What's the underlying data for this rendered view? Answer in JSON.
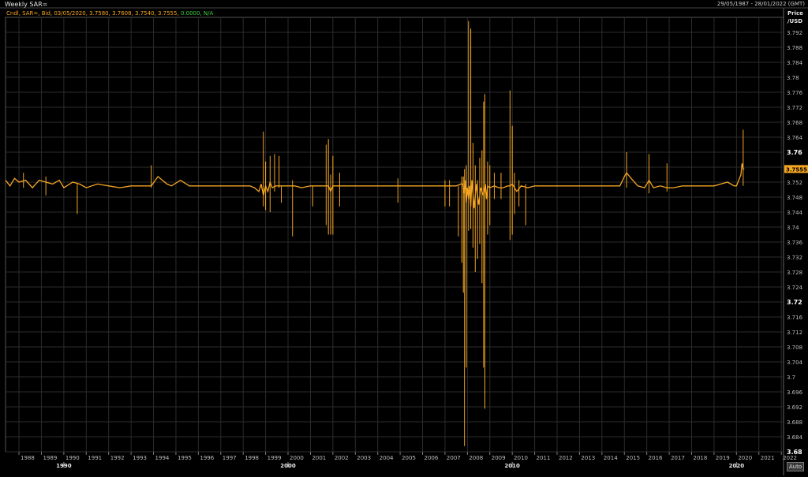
{
  "header": {
    "title": "Weekly SAR=",
    "date_range": "29/05/1987 - 28/01/2022 (GMT)"
  },
  "legend": {
    "series_text": "Cndl, SAR=, Bid, 03/05/2020, 3.7580, 3.7608, 3.7540, 3.7555,",
    "change_text": "0.0000, N/A"
  },
  "axis": {
    "units_line1": "Price",
    "units_line2": "/USD",
    "auto_label": "Auto"
  },
  "colors": {
    "series": "#f5a623",
    "background": "#000000",
    "grid": "#2b2b2b",
    "last_price_bg": "#f5a623"
  },
  "chart_data": {
    "type": "line",
    "title": "Weekly SAR=",
    "xlabel": "",
    "ylabel": "Price /USD",
    "ylim": [
      3.68,
      3.796
    ],
    "xlim": [
      1987.4,
      2022.1
    ],
    "grid": true,
    "y_ticks": [
      "3.68",
      "3.684",
      "3.688",
      "3.692",
      "3.696",
      "3.7",
      "3.704",
      "3.708",
      "3.712",
      "3.716",
      "3.72",
      "3.724",
      "3.728",
      "3.732",
      "3.736",
      "3.74",
      "3.744",
      "3.748",
      "3.752",
      "3.756",
      "3.76",
      "3.764",
      "3.768",
      "3.772",
      "3.776",
      "3.78",
      "3.784",
      "3.788",
      "3.792"
    ],
    "bold_y_ticks": [
      "3.68",
      "3.72",
      "3.76"
    ],
    "year_ticks": [
      "1988",
      "1989",
      "1990",
      "1991",
      "1992",
      "1993",
      "1994",
      "1995",
      "1996",
      "1997",
      "1998",
      "1999",
      "2000",
      "2001",
      "2002",
      "2003",
      "2004",
      "2005",
      "2006",
      "2007",
      "2008",
      "2009",
      "2010",
      "2011",
      "2012",
      "2013",
      "2014",
      "2015",
      "2016",
      "2017",
      "2018",
      "2019",
      "2020",
      "2021",
      "2022"
    ],
    "decade_labels": [
      "1990",
      "2000",
      "2010",
      "2020"
    ],
    "last_price": "3.7555",
    "series": [
      {
        "x": [
          1987.4,
          1987.6,
          1987.8,
          1988.0,
          1988.3,
          1988.6,
          1988.9,
          1989.2,
          1989.5,
          1989.8,
          1990.0,
          1990.4,
          1990.7,
          1991.0,
          1991.5,
          1992.0,
          1992.5,
          1993.0,
          1993.5,
          1993.9,
          1994.2,
          1994.6,
          1994.8,
          1995.2,
          1995.6,
          1996.0,
          1996.5,
          1997.0,
          1997.5,
          1998.0,
          1998.3,
          1998.5,
          1998.7,
          1998.8,
          1998.9,
          1999.0,
          1999.1,
          1999.2,
          1999.3,
          1999.45,
          1999.6,
          1999.8,
          2000.0,
          2000.3,
          2000.6,
          2001.0,
          2001.4,
          2001.6,
          2001.8,
          2001.9,
          2002.0,
          2002.2,
          2002.5,
          2003.0,
          2003.5,
          2004.0,
          2004.5,
          2005.0,
          2005.5,
          2006.0,
          2006.5,
          2006.9,
          2007.2,
          2007.5,
          2007.7,
          2007.8,
          2007.85,
          2007.9,
          2007.95,
          2008.0,
          2008.05,
          2008.1,
          2008.15,
          2008.2,
          2008.3,
          2008.4,
          2008.5,
          2008.6,
          2008.7,
          2008.8,
          2008.85,
          2008.9,
          2009.0,
          2009.2,
          2009.4,
          2009.6,
          2009.8,
          2009.9,
          2010.0,
          2010.2,
          2010.4,
          2010.7,
          2011.0,
          2011.5,
          2012.0,
          2012.5,
          2013.0,
          2013.5,
          2014.0,
          2014.5,
          2014.8,
          2015.0,
          2015.1,
          2015.3,
          2015.6,
          2015.9,
          2016.0,
          2016.1,
          2016.3,
          2016.6,
          2016.9,
          2017.2,
          2017.6,
          2018.0,
          2018.5,
          2019.0,
          2019.3,
          2019.6,
          2019.9,
          2020.0,
          2020.1,
          2020.2,
          2020.25,
          2020.3,
          2020.35
        ],
        "y": [
          3.7525,
          3.751,
          3.753,
          3.752,
          3.7525,
          3.7505,
          3.7525,
          3.752,
          3.7515,
          3.7525,
          3.7505,
          3.752,
          3.7515,
          3.7505,
          3.7515,
          3.751,
          3.7505,
          3.751,
          3.751,
          3.751,
          3.7535,
          3.7515,
          3.751,
          3.7525,
          3.751,
          3.751,
          3.751,
          3.751,
          3.751,
          3.751,
          3.751,
          3.7505,
          3.7495,
          3.7515,
          3.7485,
          3.751,
          3.7495,
          3.752,
          3.7505,
          3.751,
          3.751,
          3.751,
          3.751,
          3.751,
          3.7505,
          3.751,
          3.751,
          3.751,
          3.751,
          3.7495,
          3.751,
          3.751,
          3.751,
          3.751,
          3.751,
          3.751,
          3.751,
          3.751,
          3.751,
          3.751,
          3.751,
          3.751,
          3.751,
          3.751,
          3.7515,
          3.7515,
          3.749,
          3.7525,
          3.7465,
          3.7505,
          3.7475,
          3.751,
          3.7455,
          3.7525,
          3.745,
          3.7515,
          3.746,
          3.7505,
          3.7485,
          3.7515,
          3.7475,
          3.751,
          3.7505,
          3.751,
          3.7505,
          3.7505,
          3.751,
          3.751,
          3.7515,
          3.7495,
          3.751,
          3.7505,
          3.751,
          3.751,
          3.751,
          3.751,
          3.751,
          3.751,
          3.751,
          3.751,
          3.751,
          3.7535,
          3.7545,
          3.753,
          3.751,
          3.7505,
          3.7515,
          3.7525,
          3.7505,
          3.751,
          3.7505,
          3.7505,
          3.751,
          3.751,
          3.751,
          3.751,
          3.7515,
          3.752,
          3.751,
          3.751,
          3.7525,
          3.754,
          3.757,
          3.7555,
          3.7555
        ]
      }
    ],
    "spikes": [
      [
        1988.2,
        3.7545,
        3.7505
      ],
      [
        1989.2,
        3.7535,
        3.7485
      ],
      [
        1990.6,
        3.7515,
        3.7435
      ],
      [
        1993.9,
        3.7565,
        3.7505
      ],
      [
        1998.9,
        3.7655,
        3.7455
      ],
      [
        1999.0,
        3.7575,
        3.7445
      ],
      [
        1999.2,
        3.759,
        3.744
      ],
      [
        1999.4,
        3.7595,
        3.7495
      ],
      [
        1999.6,
        3.759,
        3.7505
      ],
      [
        1999.7,
        3.751,
        3.7465
      ],
      [
        2000.2,
        3.7525,
        3.7375
      ],
      [
        2001.1,
        3.751,
        3.7455
      ],
      [
        2001.7,
        3.762,
        3.7405
      ],
      [
        2001.8,
        3.7635,
        3.738
      ],
      [
        2001.9,
        3.754,
        3.738
      ],
      [
        2002.0,
        3.759,
        3.738
      ],
      [
        2002.3,
        3.7545,
        3.7455
      ],
      [
        2004.9,
        3.753,
        3.7465
      ],
      [
        2007.0,
        3.7525,
        3.7455
      ],
      [
        2007.2,
        3.7525,
        3.7455
      ],
      [
        2007.6,
        3.751,
        3.7375
      ],
      [
        2007.75,
        3.7535,
        3.7305
      ],
      [
        2007.82,
        3.7535,
        3.7225
      ],
      [
        2007.87,
        3.7555,
        3.6815
      ],
      [
        2007.95,
        3.7565,
        3.7025
      ],
      [
        2008.05,
        3.795,
        3.739
      ],
      [
        2008.15,
        3.793,
        3.7395
      ],
      [
        2008.25,
        3.7625,
        3.7345
      ],
      [
        2008.35,
        3.7565,
        3.728
      ],
      [
        2008.45,
        3.7525,
        3.7315
      ],
      [
        2008.55,
        3.7585,
        3.7355
      ],
      [
        2008.65,
        3.7605,
        3.725
      ],
      [
        2008.72,
        3.7735,
        3.7025
      ],
      [
        2008.78,
        3.7755,
        3.6915
      ],
      [
        2008.9,
        3.7575,
        3.738
      ],
      [
        2009.0,
        3.7565,
        3.7405
      ],
      [
        2009.2,
        3.7545,
        3.7475
      ],
      [
        2009.5,
        3.7545,
        3.7475
      ],
      [
        2009.9,
        3.7765,
        3.7365
      ],
      [
        2010.0,
        3.767,
        3.738
      ],
      [
        2010.1,
        3.7545,
        3.7435
      ],
      [
        2010.3,
        3.7525,
        3.7455
      ],
      [
        2010.6,
        3.7515,
        3.7405
      ],
      [
        2015.1,
        3.76,
        3.7505
      ],
      [
        2016.1,
        3.7595,
        3.749
      ],
      [
        2016.9,
        3.757,
        3.7495
      ],
      [
        2020.3,
        3.766,
        3.751
      ]
    ]
  }
}
